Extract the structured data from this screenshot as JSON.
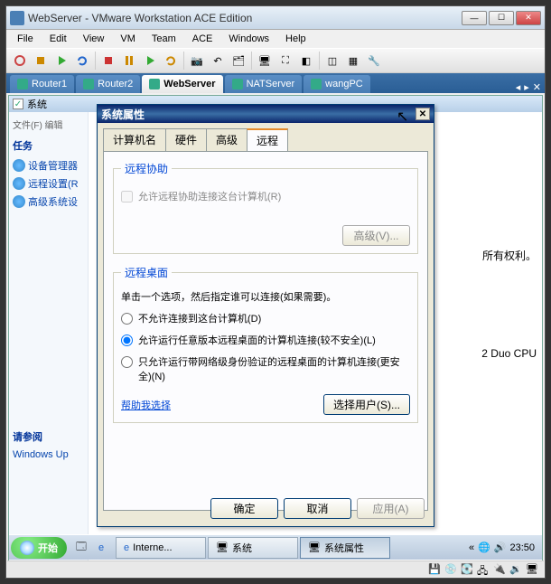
{
  "vmware": {
    "title": "WebServer - VMware Workstation ACE Edition",
    "menu": [
      "File",
      "Edit",
      "View",
      "VM",
      "Team",
      "ACE",
      "Windows",
      "Help"
    ],
    "tabs": [
      {
        "label": "Router1"
      },
      {
        "label": "Router2"
      },
      {
        "label": "WebServer",
        "active": true
      },
      {
        "label": "NATServer"
      },
      {
        "label": "wangPC"
      }
    ]
  },
  "guest": {
    "toplabel": "系统",
    "sidebar": {
      "filehdr": "文件(F)    编辑",
      "tasks_header": "任务",
      "links": [
        "设备管理器",
        "远程设置(R",
        "高级系统设"
      ],
      "seealso": "请参阅",
      "bottomlink": "Windows Up"
    },
    "main_snippet_right": "所有权利。",
    "main_snippet_cpu": "2 Duo CPU"
  },
  "dialog": {
    "title": "系统属性",
    "tabs": [
      "计算机名",
      "硬件",
      "高级",
      "远程"
    ],
    "active_tab": 3,
    "remote_assist": {
      "legend": "远程协助",
      "checkbox": "允许远程协助连接这台计算机(R)",
      "advanced_btn": "高级(V)..."
    },
    "remote_desktop": {
      "legend": "远程桌面",
      "instruction": "单击一个选项，然后指定谁可以连接(如果需要)。",
      "radio1": "不允许连接到这台计算机(D)",
      "radio2": "允许运行任意版本远程桌面的计算机连接(较不安全)(L)",
      "radio3": "只允许运行带网络级身份验证的远程桌面的计算机连接(更安全)(N)",
      "help_link": "帮助我选择",
      "select_users_btn": "选择用户(S)..."
    },
    "buttons": {
      "ok": "确定",
      "cancel": "取消",
      "apply": "应用(A)"
    }
  },
  "taskbar": {
    "start": "开始",
    "buttons": [
      "Interne...",
      "系统",
      "系统属性"
    ],
    "clock": "23:50"
  }
}
